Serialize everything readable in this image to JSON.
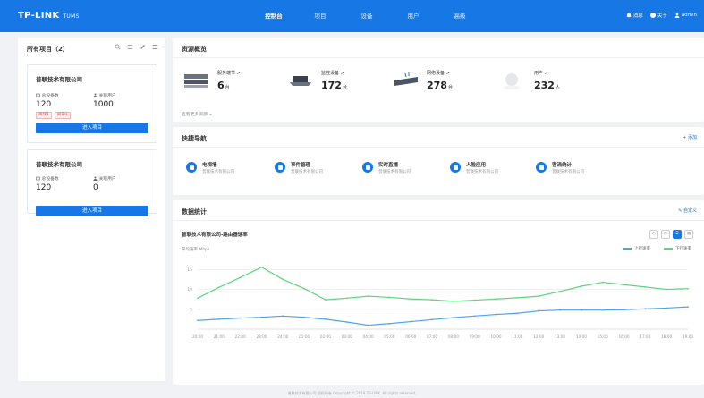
{
  "app": {
    "logo": "TP-LINK",
    "logo_sub": "TUMS"
  },
  "nav": [
    {
      "label": "控制台",
      "active": true
    },
    {
      "label": "项目",
      "active": false
    },
    {
      "label": "设备",
      "active": false
    },
    {
      "label": "用户",
      "active": false
    },
    {
      "label": "高级",
      "active": false
    }
  ],
  "top_right": {
    "message": "消息",
    "about": "关于",
    "user": "admin"
  },
  "left_panel": {
    "title": "所有项目（2）",
    "projects": [
      {
        "name": "普联技术有限公司",
        "device_label": "总设备数",
        "device_count": "120",
        "user_label": "关联用户",
        "user_count": "1000",
        "tags": [
          "离线1",
          "异常1"
        ],
        "button": "进入项目"
      },
      {
        "name": "普联技术有限公司",
        "device_label": "总设备数",
        "device_count": "120",
        "user_label": "关联用户",
        "user_count": "0",
        "tags": [],
        "button": "进入项目"
      }
    ]
  },
  "resources": {
    "title": "资源概览",
    "items": [
      {
        "name": "服务端节",
        "count": "6",
        "unit": "台"
      },
      {
        "name": "监控设备",
        "count": "172",
        "unit": "台"
      },
      {
        "name": "网络设备",
        "count": "278",
        "unit": "台"
      },
      {
        "name": "用户",
        "count": "232",
        "unit": "人"
      }
    ],
    "view_more": "查看更多资源"
  },
  "quick_nav": {
    "title": "快捷导航",
    "add": "添加",
    "items": [
      {
        "name": "电视墙",
        "sub": "普联技术有限公司"
      },
      {
        "name": "事件管理",
        "sub": "普联技术有限公司"
      },
      {
        "name": "实时直播",
        "sub": "普联技术有限公司"
      },
      {
        "name": "人脸应用",
        "sub": "普联技术有限公司"
      },
      {
        "name": "客流统计",
        "sub": "普联技术有限公司"
      }
    ]
  },
  "stats": {
    "title": "数据统计",
    "customize": "自定义",
    "controls": [
      "◷",
      "◷",
      "⌸",
      "▤"
    ]
  },
  "colors": {
    "primary": "#1677e5",
    "upload": "#4aa3f2",
    "download": "#5fd47f"
  },
  "chart_data": {
    "type": "line",
    "title": "普联技术有限公司-路由器速率",
    "ylabel": "平均速率 Mbps",
    "x": [
      "20:00",
      "21:00",
      "22:00",
      "23:00",
      "24:00",
      "01:00",
      "02:00",
      "03:00",
      "04:00",
      "05:00",
      "06:00",
      "07:00",
      "08:00",
      "09:00",
      "10:00",
      "11:00",
      "12:00",
      "13:00",
      "14:00",
      "15:00",
      "16:00",
      "17:00",
      "18:00",
      "19:00"
    ],
    "ylim": [
      0,
      18
    ],
    "yticks": [
      "15",
      "10",
      "5"
    ],
    "grid": true,
    "legend_position": "top-right",
    "series": [
      {
        "name": "上行速率",
        "color": "#4aa3f2",
        "values": [
          2.2,
          2.5,
          2.8,
          3.0,
          3.3,
          3.0,
          2.5,
          1.8,
          1.0,
          1.4,
          1.9,
          2.4,
          2.9,
          3.3,
          3.7,
          4.0,
          4.6,
          4.8,
          4.8,
          4.8,
          4.9,
          5.1,
          5.3,
          5.6
        ]
      },
      {
        "name": "下行速率",
        "color": "#5fd47f",
        "values": [
          7.8,
          10.5,
          13.0,
          15.6,
          12.5,
          10.2,
          7.4,
          7.8,
          8.3,
          8.0,
          7.6,
          7.4,
          7.0,
          7.3,
          7.6,
          7.9,
          8.3,
          9.5,
          10.8,
          11.8,
          11.2,
          10.6,
          10.0,
          10.2
        ]
      }
    ]
  },
  "footer": "普联技术有限公司 版权所有 Copyright © 2018 TP-LINK. All rights reserved."
}
